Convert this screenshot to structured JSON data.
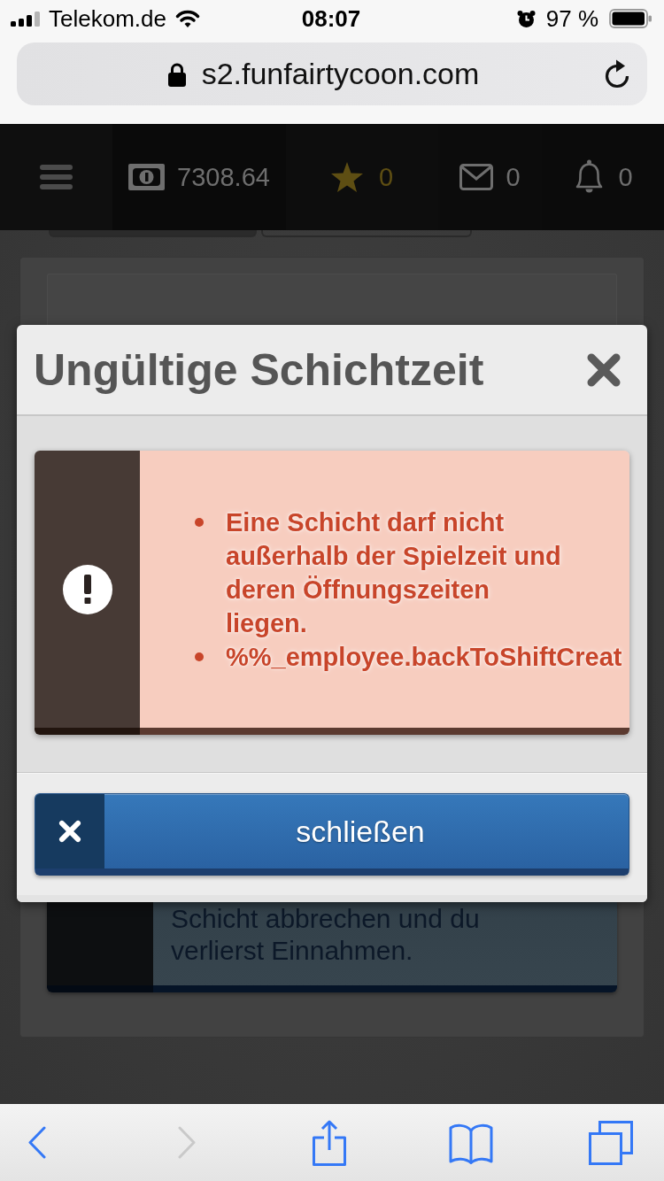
{
  "status_bar": {
    "carrier": "Telekom.de",
    "time": "08:07",
    "battery": "97 %"
  },
  "address_bar": {
    "url": "s2.funfairtycoon.com"
  },
  "nav": [
    {
      "kind": "menu"
    },
    {
      "kind": "money",
      "value": "7308.64"
    },
    {
      "kind": "star",
      "value": "0"
    },
    {
      "kind": "mail",
      "value": "0"
    },
    {
      "kind": "bell",
      "value": "0"
    }
  ],
  "background": {
    "notice": "Schicht abbrechen und du verlierst Einnahmen."
  },
  "dialog": {
    "title": "Ungültige Schichtzeit",
    "errors": [
      "Eine Schicht darf nicht außerhalb der Spielzeit und deren Öffnungszeiten liegen.",
      "%%_employee.backToShiftCreat"
    ],
    "button": "schließen"
  },
  "toolbar": [
    {
      "kind": "back",
      "disabled": false
    },
    {
      "kind": "forward",
      "disabled": true
    },
    {
      "kind": "share",
      "disabled": false
    },
    {
      "kind": "bookmarks",
      "disabled": false
    },
    {
      "kind": "tabs",
      "disabled": false
    }
  ]
}
